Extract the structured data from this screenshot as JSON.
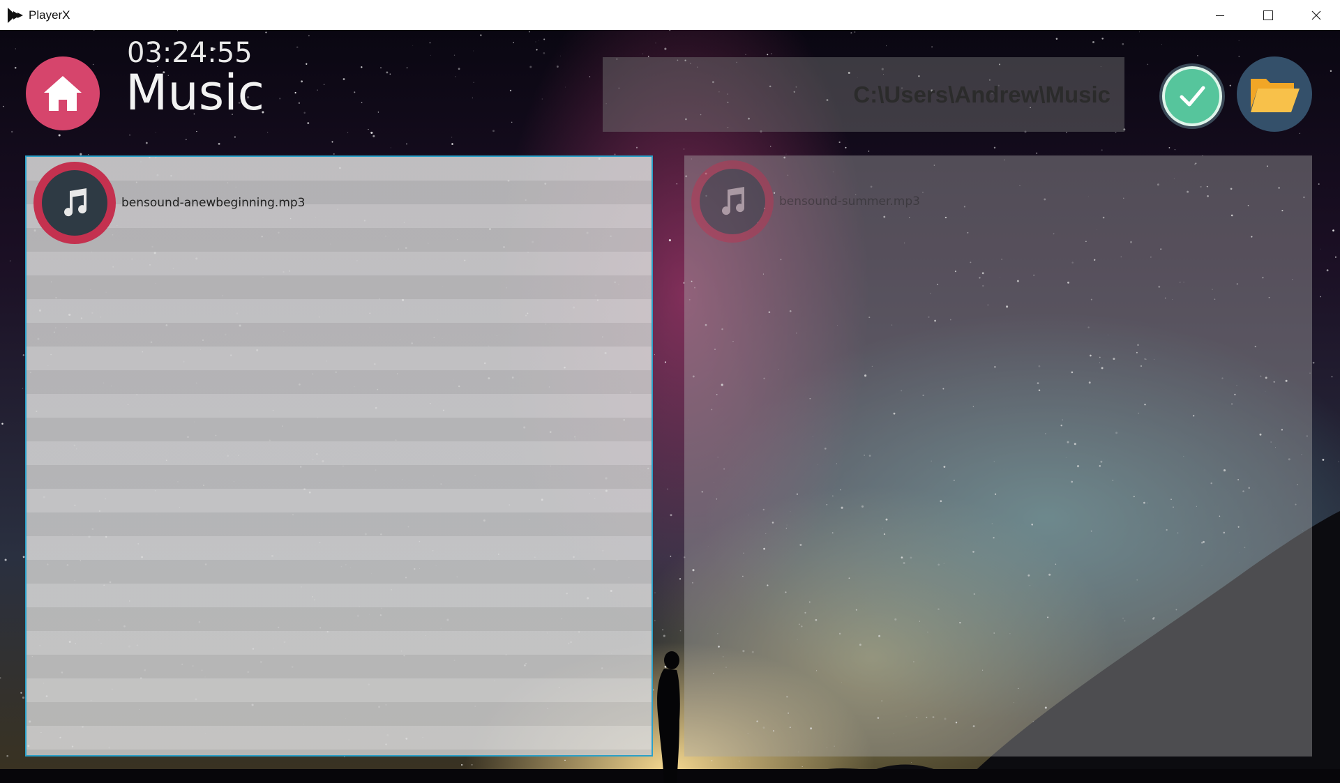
{
  "window": {
    "title": "PlayerX",
    "controls": {
      "minimize_icon": "minimize-icon",
      "maximize_icon": "maximize-icon",
      "close_icon": "close-icon"
    }
  },
  "header": {
    "clock": "03:24:55",
    "title": "Music",
    "path": "C:\\Users\\Andrew\\Music",
    "home_icon": "home-icon",
    "confirm_icon": "checkmark-icon",
    "folder_icon": "folder-open-icon"
  },
  "panels": {
    "left": {
      "tracks": [
        {
          "name": "bensound-anewbeginning.mp3",
          "icon": "music-note-icon"
        }
      ]
    },
    "right": {
      "tracks": [
        {
          "name": "bensound-summer.mp3",
          "icon": "music-note-icon"
        }
      ]
    }
  },
  "colors": {
    "home": "#d6456c",
    "confirm": "#56c59c",
    "folder": "#34506a",
    "folder_icon": "#f6b73c",
    "track_ring": "#c4314f",
    "selection_border": "#2aa0c8"
  }
}
